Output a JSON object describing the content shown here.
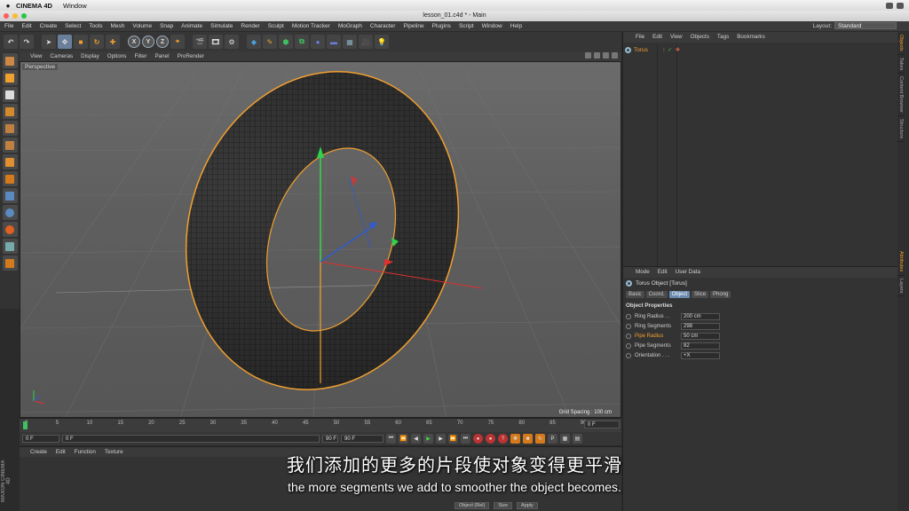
{
  "mac_menubar": {
    "app_name": "CINEMA 4D",
    "window_menu": "Window"
  },
  "window": {
    "title": "lesson_01.c4d * - Main"
  },
  "app_menu": [
    "File",
    "Edit",
    "Create",
    "Select",
    "Tools",
    "Mesh",
    "Volume",
    "Snap",
    "Animate",
    "Simulate",
    "Render",
    "Sculpt",
    "Motion Tracker",
    "MoGraph",
    "Character",
    "Pipeline",
    "Plugins",
    "Script",
    "Window",
    "Help"
  ],
  "layout": {
    "label": "Layout:",
    "value": "Standard"
  },
  "axis_buttons": [
    "X",
    "Y",
    "Z"
  ],
  "viewport": {
    "menu": [
      "View",
      "Cameras",
      "Display",
      "Options",
      "Filter",
      "Panel",
      "ProRender"
    ],
    "label": "Perspective",
    "grid_spacing": "Grid Spacing : 100 cm"
  },
  "timeline": {
    "ticks": [
      "0",
      "5",
      "10",
      "15",
      "20",
      "25",
      "30",
      "35",
      "40",
      "45",
      "50",
      "55",
      "60",
      "65",
      "70",
      "75",
      "80",
      "85",
      "90"
    ],
    "frame_value": "0 F"
  },
  "transport": {
    "start": "0 F",
    "current": "0 F",
    "end_a": "90 F",
    "end_b": "90 F"
  },
  "material_panel": {
    "menu": [
      "Create",
      "Edit",
      "Function",
      "Texture"
    ],
    "buttons": [
      "Object (Rel)",
      "Size",
      "Apply"
    ],
    "brand": "MAXON CINEMA 4D"
  },
  "object_manager": {
    "menu": [
      "File",
      "Edit",
      "View",
      "Objects",
      "Tags",
      "Bookmarks"
    ],
    "objects": [
      {
        "name": "Torus"
      }
    ]
  },
  "attributes": {
    "menu": [
      "Mode",
      "Edit",
      "User Data"
    ],
    "object_title": "Torus Object [Torus]",
    "tabs": [
      "Basic",
      "Coord.",
      "Object",
      "Slice",
      "Phong"
    ],
    "active_tab": "Object",
    "section": "Object Properties",
    "props": [
      {
        "label": "Ring Radius . .",
        "value": "200 cm",
        "highlight": false
      },
      {
        "label": "Ring Segments",
        "value": "298",
        "highlight": false
      },
      {
        "label": "Pipe Radius",
        "value": "50 cm",
        "highlight": true
      },
      {
        "label": "Pipe Segments",
        "value": "82",
        "highlight": false
      },
      {
        "label": "Orientation . . .",
        "value": "+X",
        "highlight": false
      }
    ]
  },
  "right_tabs": [
    "Objects",
    "Takes",
    "Content Browser",
    "Structure",
    "Attributes",
    "Layers"
  ],
  "subtitles": {
    "zh": "我们添加的更多的片段使对象变得更平滑",
    "en": "the more segments we add to smoother the object becomes."
  },
  "colors": {
    "selection_orange": "#f0a030",
    "axis_y": "#2fd34a",
    "axis_x": "#e03030",
    "axis_z": "#2f5bd3"
  }
}
